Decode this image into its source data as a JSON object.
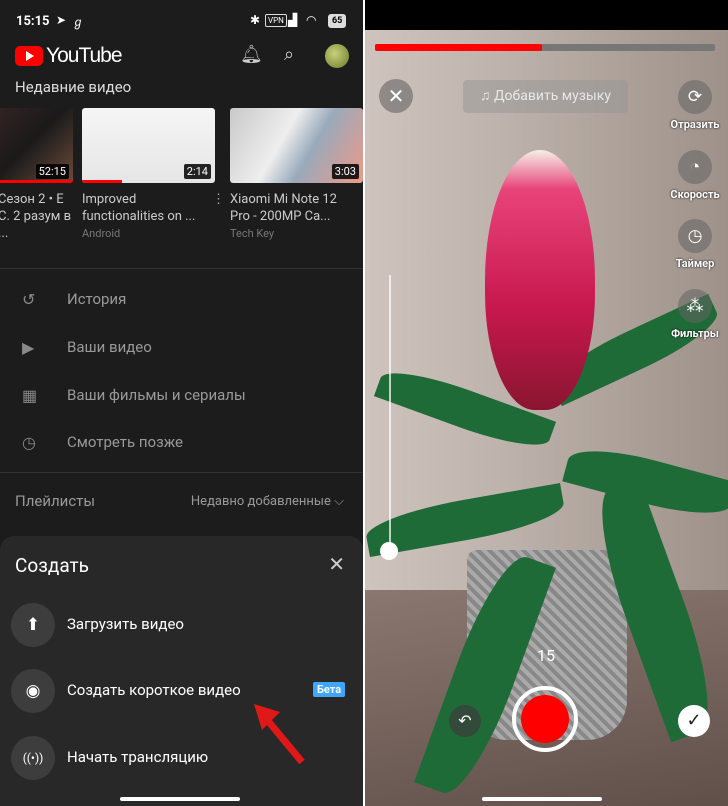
{
  "status": {
    "time": "15:15",
    "battery": "65",
    "vpn": "VPN"
  },
  "header": {
    "logo_text": "YouTube"
  },
  "recent": {
    "title": "Недавние видео",
    "videos": [
      {
        "title": "Сезон 2 • Е С. 2 разум в ...",
        "duration": "52:15"
      },
      {
        "title": "Improved functionalities on ...",
        "channel": "Android",
        "duration": "2:14"
      },
      {
        "title": "Xiaomi Mi Note 12 Pro - 200MP Ca...",
        "channel": "Tech Key",
        "duration": "3:03"
      }
    ]
  },
  "menu": [
    {
      "icon": "history-icon",
      "glyph": "↺",
      "label": "История"
    },
    {
      "icon": "your-videos-icon",
      "glyph": "▶",
      "label": "Ваши видео"
    },
    {
      "icon": "movies-icon",
      "glyph": "▦",
      "label": "Ваши фильмы и сериалы"
    },
    {
      "icon": "watch-later-icon",
      "glyph": "◷",
      "label": "Смотреть позже"
    }
  ],
  "playlists": {
    "title": "Плейлисты",
    "sort": "Недавно добавленные"
  },
  "sheet": {
    "title": "Создать",
    "options": [
      {
        "label": "Загрузить видео",
        "glyph": "⬆"
      },
      {
        "label": "Создать короткое видео",
        "glyph": "◉"
      },
      {
        "label": "Начать трансляцию",
        "glyph": "((•))"
      }
    ],
    "badge": "Бета"
  },
  "camera": {
    "add_music": "♫ Добавить музыку",
    "progress": 0.49,
    "tools": [
      {
        "label": "Отразить",
        "glyph": "⟳"
      },
      {
        "label": "Скорость",
        "glyph": "◔"
      },
      {
        "label": "Таймер",
        "glyph": "◷"
      },
      {
        "label": "Фильтры",
        "glyph": "⁂"
      }
    ],
    "countdown": "15"
  },
  "colors": {
    "accent": "#ff0000",
    "badge": "#3ea6ff"
  }
}
